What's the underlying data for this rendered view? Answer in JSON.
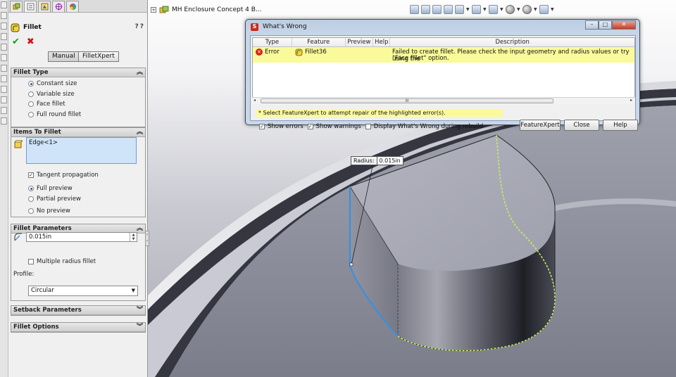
{
  "panel": {
    "title": "Fillet",
    "help_symbols": [
      "?",
      "?"
    ],
    "ok_symbol": "✔",
    "cancel_symbol": "✖",
    "mode_manual": "Manual",
    "mode_xpert": "FilletXpert",
    "fillet_type": {
      "header": "Fillet Type",
      "options": [
        "Constant size",
        "Variable size",
        "Face fillet",
        "Full round fillet"
      ],
      "selected": "Constant size"
    },
    "items": {
      "header": "Items To Fillet",
      "edge_item": "Edge<1>",
      "tangent_propagation": "Tangent propagation",
      "preview_options": [
        "Full preview",
        "Partial preview",
        "No preview"
      ],
      "selected_preview": "Full preview"
    },
    "parameters": {
      "header": "Fillet Parameters",
      "radius_value": "0.015in",
      "multiple_radius": "Multiple radius fillet",
      "profile_label": "Profile:",
      "profile_value": "Circular"
    },
    "setback_header": "Setback Parameters",
    "options_header": "Fillet Options"
  },
  "viewport": {
    "tree_title": "MH Enclosure Concept 4 B...",
    "callout_label": "Radius:",
    "callout_value": "0.015in",
    "colors": {
      "edge_selected": "#3b8fe0",
      "edge_preview": "#c8f060"
    }
  },
  "dialog": {
    "title": "What's Wrong",
    "columns": [
      "Type",
      "Feature",
      "Preview",
      "Help",
      "Description"
    ],
    "row": {
      "type": "Error",
      "feature": "Fillet36",
      "description_line1": "Failed to create fillet.  Please check the input geometry and radius values or try using the",
      "description_line2": "\"Face fillet\" option."
    },
    "scroll_label": "III",
    "hint": "* Select FeatureXpert to attempt repair of the highlighted error(s).",
    "show_errors": "Show errors",
    "show_warnings": "Show warnings",
    "display_during_rebuild": "Display What's Wrong during rebuild",
    "btn_featurexpert": "FeatureXpert",
    "btn_close": "Close",
    "btn_help": "Help"
  }
}
